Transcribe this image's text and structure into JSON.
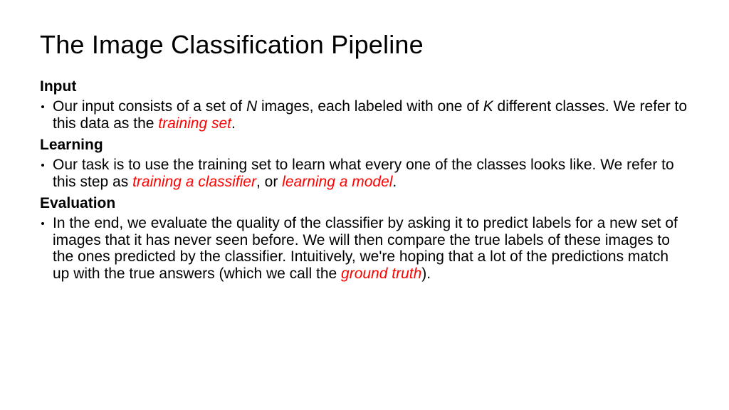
{
  "title": "The Image Classification Pipeline",
  "sections": {
    "input": {
      "header": "Input",
      "text_parts": {
        "p1": "Our input consists of a set of ",
        "var1": "N",
        "p2": " images, each labeled with one of ",
        "var2": "K",
        "p3": " different classes. We refer to this data as the ",
        "term1": "training set",
        "p4": "."
      }
    },
    "learning": {
      "header": "Learning",
      "text_parts": {
        "p1": "Our task is to use the training set to learn what every one of the classes looks like. We refer to this step as ",
        "term1": "training a classifier",
        "p2": ", or ",
        "term2": "learning a model",
        "p3": "."
      }
    },
    "evaluation": {
      "header": "Evaluation",
      "text_parts": {
        "p1": "In the end, we evaluate the quality of the classifier by asking it to predict labels for a new set of images that it has never seen before. We will then compare the true labels of these images to the ones predicted by the classifier. Intuitively, we're hoping that a lot of the predictions match up with the true answers (which we call the ",
        "term1": "ground truth",
        "p2": ")."
      }
    }
  }
}
